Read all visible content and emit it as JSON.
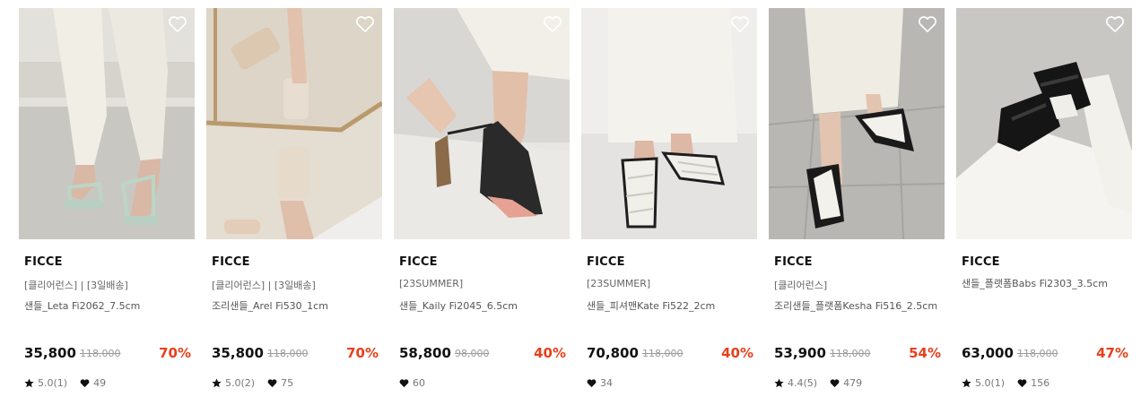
{
  "products": [
    {
      "brand": "FICCE",
      "tag": "[클리어런스] | [3일배송]",
      "name": "샌들_Leta Fi2062_7.5cm",
      "price": "35,800",
      "original_price": "118,000",
      "discount": "70%",
      "rating": "5.0(1)",
      "likes": "49",
      "image_alt": "woman in white pants wearing mint strappy heeled sandals"
    },
    {
      "brand": "FICCE",
      "tag": "[클리어런스] | [3일배송]",
      "name": "조리샌들_Arel Fi530_1cm",
      "price": "35,800",
      "original_price": "118,000",
      "discount": "70%",
      "rating": "5.0(2)",
      "likes": "75",
      "image_alt": "beige square-strap slides reflected in a mirror"
    },
    {
      "brand": "FICCE",
      "tag": "[23SUMMER]",
      "name": "샌들_Kaily Fi2045_6.5cm",
      "price": "58,800",
      "original_price": "98,000",
      "discount": "40%",
      "rating": null,
      "likes": "60",
      "image_alt": "hand adjusting black ankle-strap heeled sandal"
    },
    {
      "brand": "FICCE",
      "tag": "[23SUMMER]",
      "name": "샌들_피셔맨Kate Fi522_2cm",
      "price": "70,800",
      "original_price": "118,000",
      "discount": "40%",
      "rating": null,
      "likes": "34",
      "image_alt": "white woven fisherman sandals with black soles"
    },
    {
      "brand": "FICCE",
      "tag": "[클리어런스]",
      "name": "조리샌들_플랫폼Kesha Fi516_2.5cm",
      "price": "53,900",
      "original_price": "118,000",
      "discount": "54%",
      "rating": "4.4(5)",
      "likes": "479",
      "image_alt": "white thong strap platform sandals on grey tiles"
    },
    {
      "brand": "FICCE",
      "tag": "",
      "name": "샌들_플랫폼Babs Fi2303_3.5cm",
      "price": "63,000",
      "original_price": "118,000",
      "discount": "47%",
      "rating": "5.0(1)",
      "likes": "156",
      "image_alt": "black padded strap platform sandals worn with white socks"
    }
  ],
  "icons": {
    "wishlist": "heart-outline-icon",
    "rating": "star-icon",
    "likes": "heart-filled-icon"
  },
  "colors": {
    "discount": "#e8401c",
    "brand_text": "#111111",
    "muted": "#777777"
  }
}
